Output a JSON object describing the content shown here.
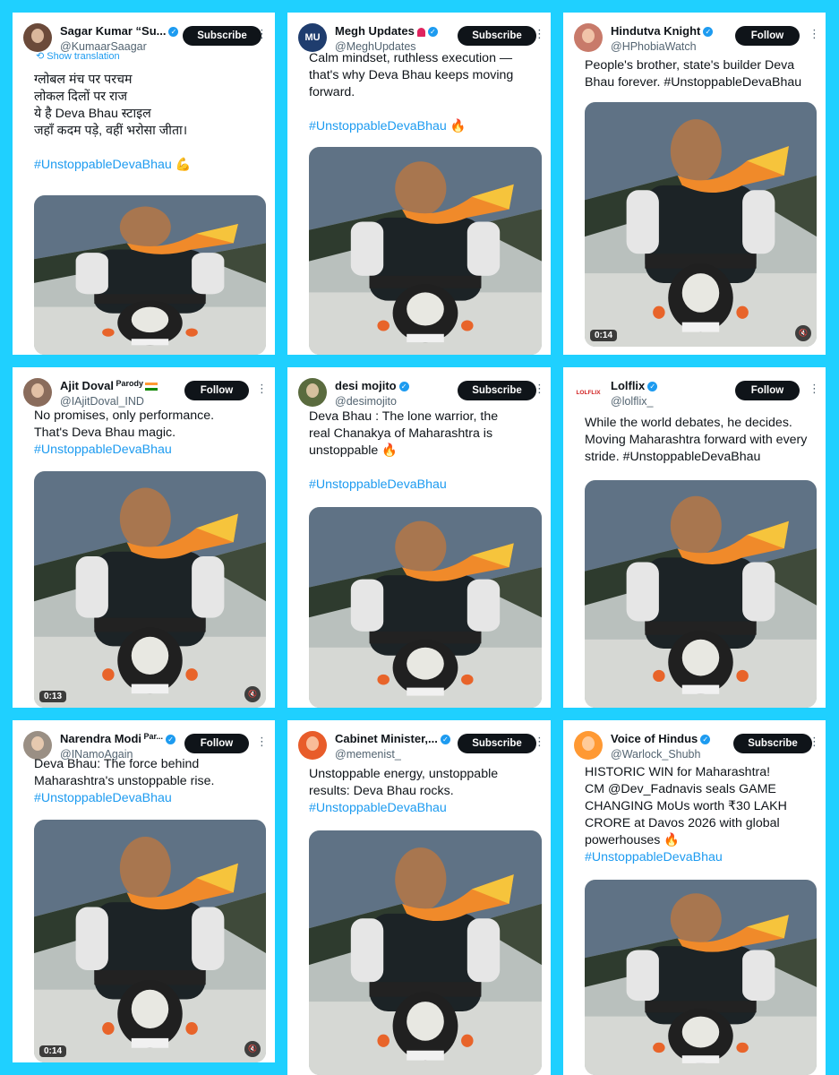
{
  "translate_label": "Show translation",
  "posts": [
    {
      "name": "Sagar Kumar “Su...",
      "handle": "@KumaarSaagar",
      "button": "Subscribe",
      "lines": [
        "ग्लोबल मंच पर परचम",
        "लोकल दिलों पर राज",
        "ये है Deva Bhau स्टाइल",
        "जहाँ कदम पड़े, वहीं भरोसा जीता।",
        "",
        "#UnstoppableDevaBhau 💪"
      ],
      "duration": "",
      "avatar_color": "#6b4a3a"
    },
    {
      "name": "Megh Updates",
      "handle": "@MeghUpdates",
      "button": "Subscribe",
      "lines": [
        "Calm mindset, ruthless execution —",
        "that's why Deva Bhau keeps moving",
        "forward.",
        "",
        "#UnstoppableDevaBhau 🔥"
      ],
      "duration": "",
      "avatar_color": "#1f3d6e",
      "avatar_text": "MU"
    },
    {
      "name": "Hindutva Knight",
      "handle": "@HPhobiaWatch",
      "button": "Follow",
      "lines": [
        "People's brother, state's builder Deva",
        "Bhau forever. #UnstoppableDevaBhau"
      ],
      "duration": "0:14",
      "avatar_color": "#c87a6a"
    },
    {
      "name": "Ajit Doval",
      "name_sup": "Parody",
      "handle": "@IAjitDoval_IND",
      "button": "Follow",
      "lines": [
        "No promises, only performance.",
        "That's Deva Bhau magic.",
        "#UnstoppableDevaBhau"
      ],
      "duration": "0:13",
      "avatar_color": "#8a6c5c"
    },
    {
      "name": "desi mojito",
      "handle": "@desimojito",
      "button": "Subscribe",
      "lines": [
        "Deva Bhau : The lone warrior, the",
        "real Chanakya of Maharashtra is",
        "unstoppable 🔥",
        "",
        "#UnstoppableDevaBhau"
      ],
      "duration": "",
      "avatar_color": "#5a6b3e"
    },
    {
      "name": "Lolflix",
      "handle": "@lolflix_",
      "button": "Follow",
      "lines": [
        "While the world debates, he decides.",
        "Moving Maharashtra forward with every",
        "stride. #UnstoppableDevaBhau"
      ],
      "duration": "",
      "avatar_color": "#ffffff",
      "avatar_text": "LOLFLIX"
    },
    {
      "name": "Narendra Modi",
      "name_sup": "Par...",
      "handle": "@INamoAgain",
      "button": "Follow",
      "lines": [
        "Deva Bhau: The force behind",
        "Maharashtra's unstoppable rise.",
        "#UnstoppableDevaBhau"
      ],
      "duration": "0:14",
      "avatar_color": "#9a8f84"
    },
    {
      "name": "Cabinet Minister,...",
      "handle": "@memenist_",
      "button": "Subscribe",
      "lines": [
        "Unstoppable energy, unstoppable",
        "results: Deva Bhau rocks.",
        "#UnstoppableDevaBhau"
      ],
      "duration": "",
      "avatar_color": "#e85c2a"
    },
    {
      "name": "Voice of Hindus",
      "handle": "@Warlock_Shubh",
      "button": "Subscribe",
      "lines": [
        "HISTORIC WIN for Maharashtra!",
        "CM @Dev_Fadnavis seals GAME",
        "CHANGING MoUs worth ₹30 LAKH",
        "CRORE at Davos 2026 with global",
        "powerhouses 🔥",
        "#UnstoppableDevaBhau"
      ],
      "duration": "",
      "avatar_color": "#ff9933"
    }
  ]
}
